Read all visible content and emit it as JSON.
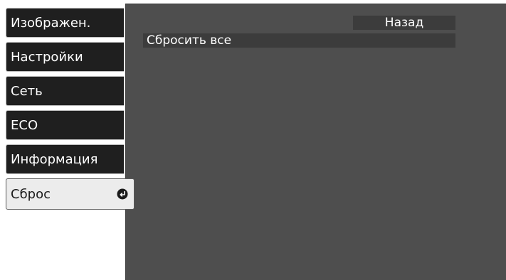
{
  "sidebar": {
    "items": [
      {
        "label": "Изображен."
      },
      {
        "label": "Настройки"
      },
      {
        "label": "Сеть"
      },
      {
        "label": "ECO"
      },
      {
        "label": "Информация"
      },
      {
        "label": "Сброс",
        "selected": true,
        "icon": "enter-icon"
      }
    ]
  },
  "main": {
    "back_label": "Назад",
    "items": [
      {
        "label": "Сбросить все"
      }
    ]
  },
  "colors": {
    "panel": "#4e4e4e",
    "tab": "#1f1f1f",
    "active_tab": "#ececec",
    "highlight_bar": "#3c3c3c"
  }
}
